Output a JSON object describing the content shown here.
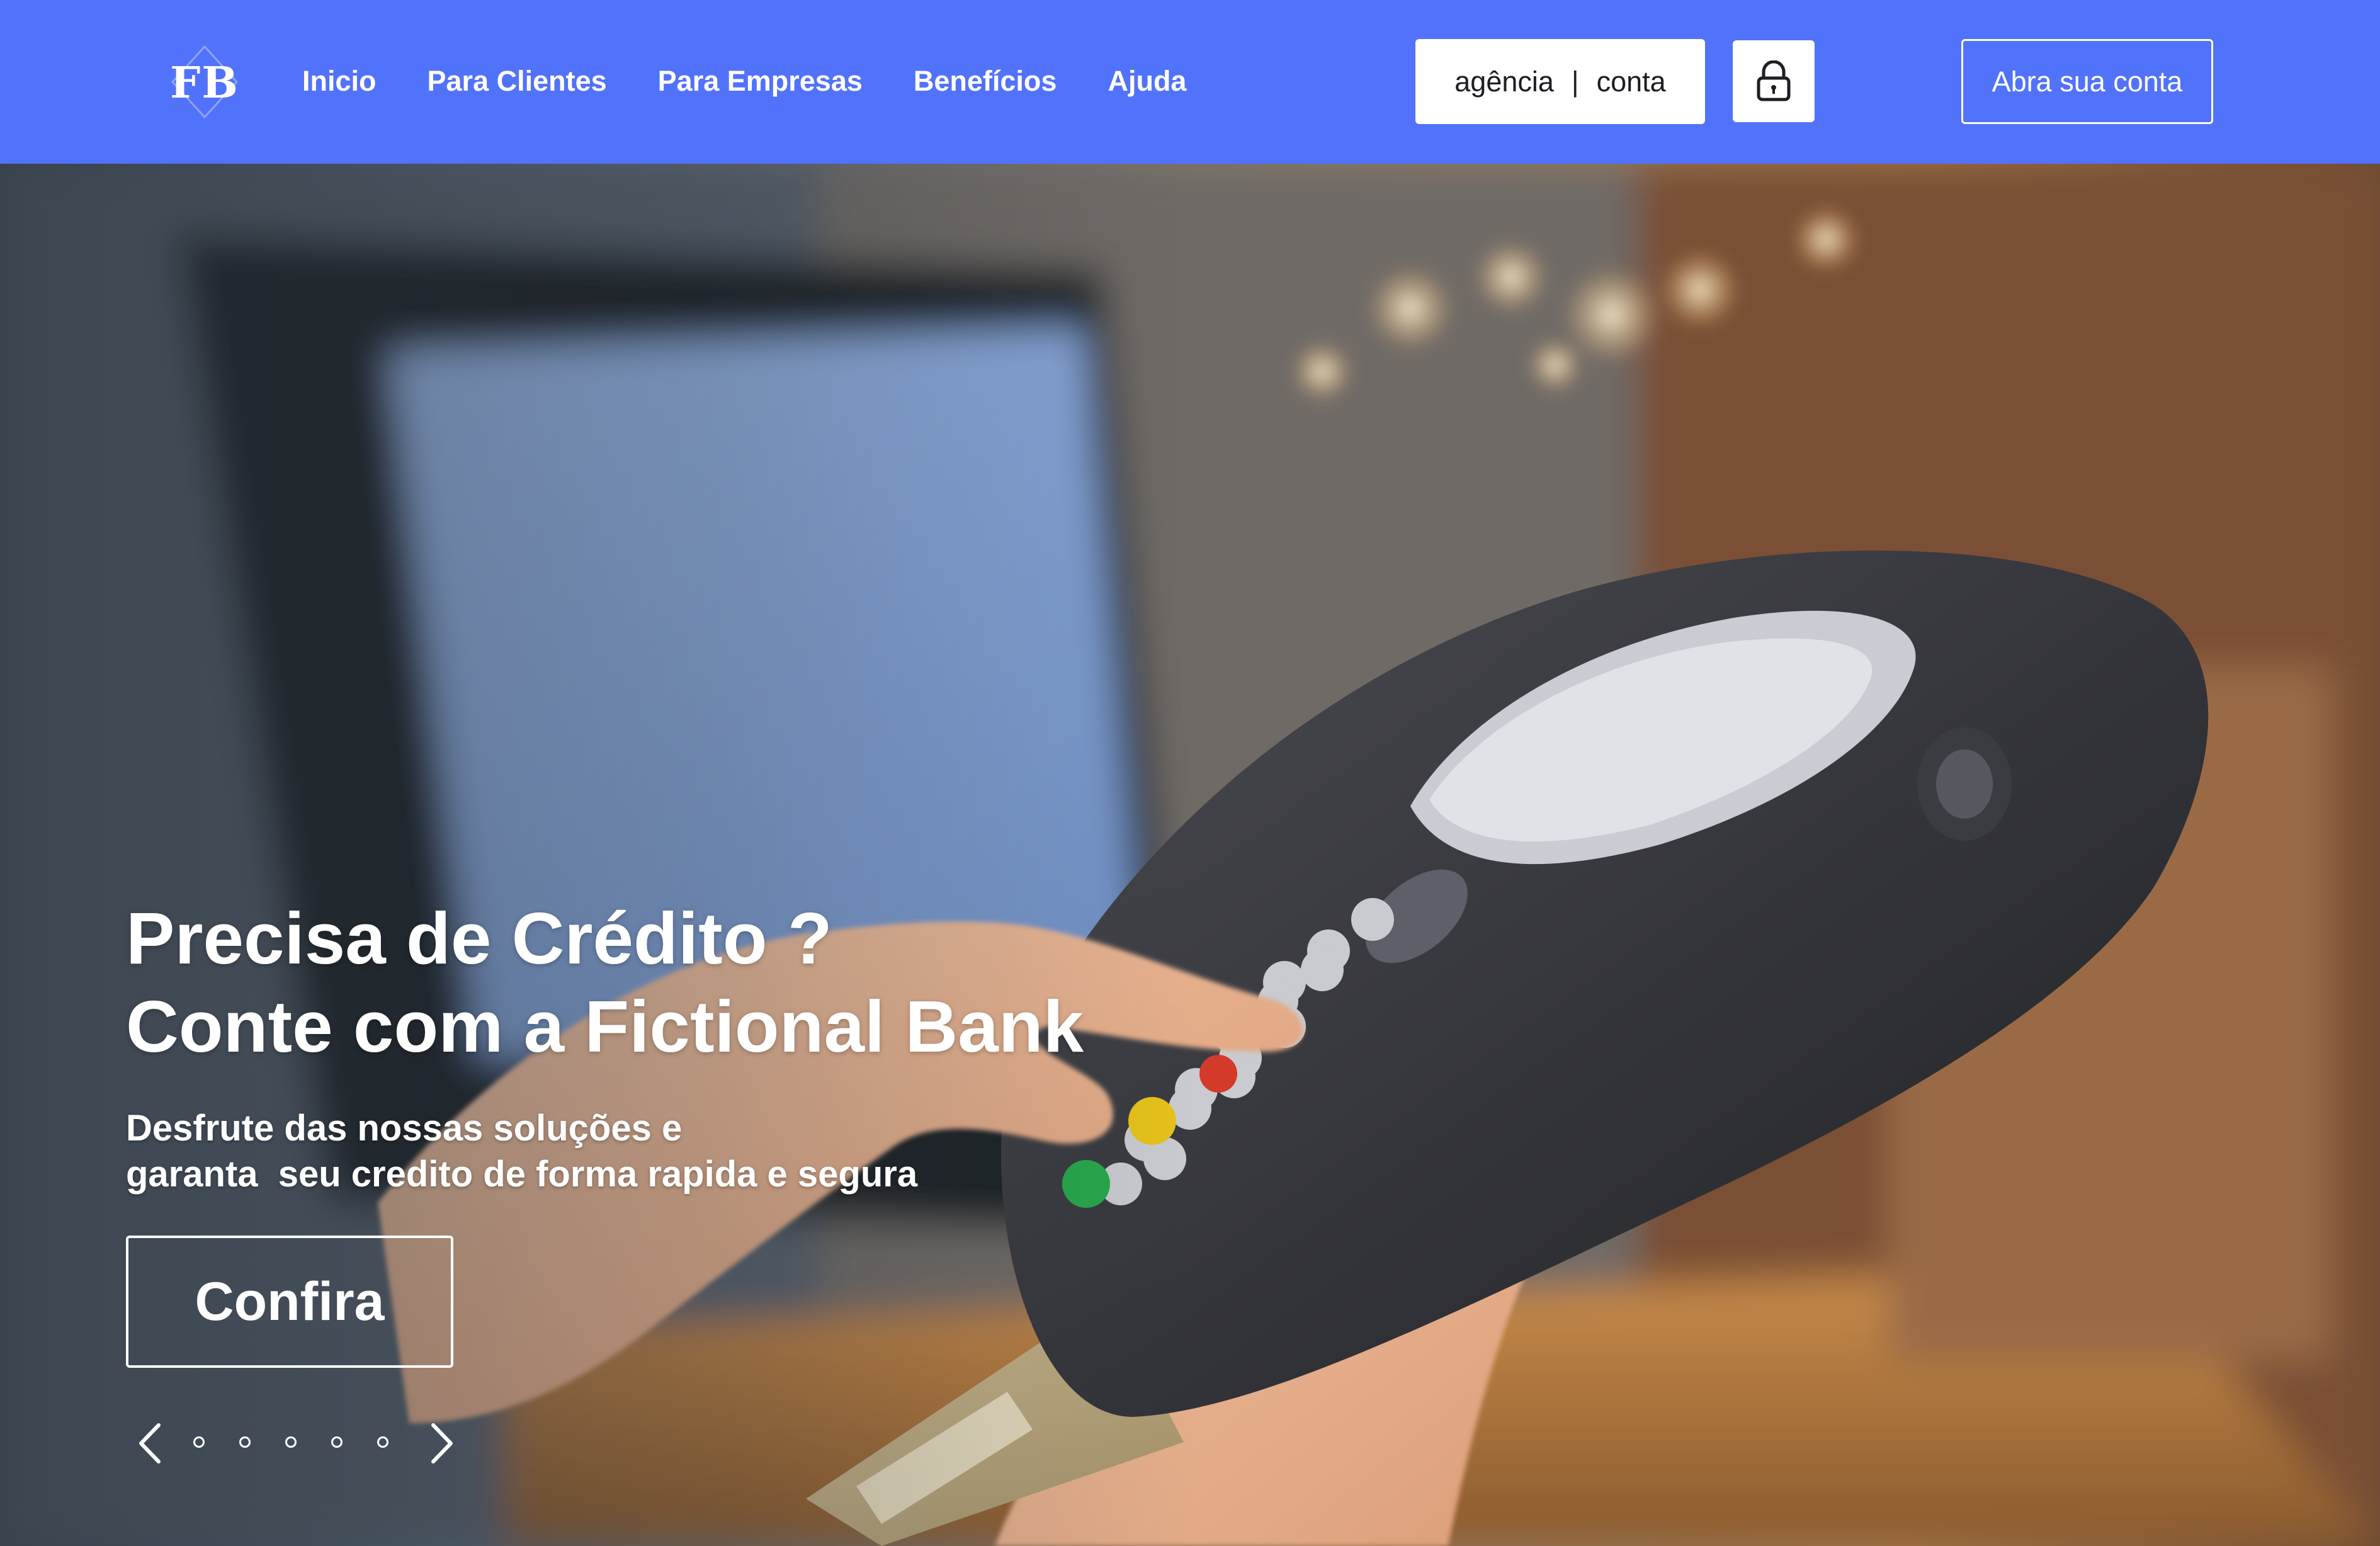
{
  "brand": {
    "logo_text": "FB",
    "accent_color": "#5172fb"
  },
  "nav": {
    "items": [
      {
        "label": "Inicio"
      },
      {
        "label": "Para Clientes"
      },
      {
        "label": "Para Empresas"
      },
      {
        "label": "Benefícios"
      },
      {
        "label": "Ajuda"
      }
    ]
  },
  "login": {
    "agency_label": "agência",
    "separator": "|",
    "account_label": "conta",
    "lock_icon": "lock-icon"
  },
  "header_cta": {
    "label": "Abra sua conta"
  },
  "hero": {
    "headline_line1": "Precisa de Crédito ?",
    "headline_line2": "Conte com a Fictional Bank",
    "subhead_line1": "Desfrute das nossas soluções e",
    "subhead_line2": "garanta  seu credito de forma rapida e segura",
    "cta_label": "Confira",
    "carousel": {
      "prev_icon": "chevron-left-icon",
      "next_icon": "chevron-right-icon",
      "dot_count": 5
    }
  }
}
